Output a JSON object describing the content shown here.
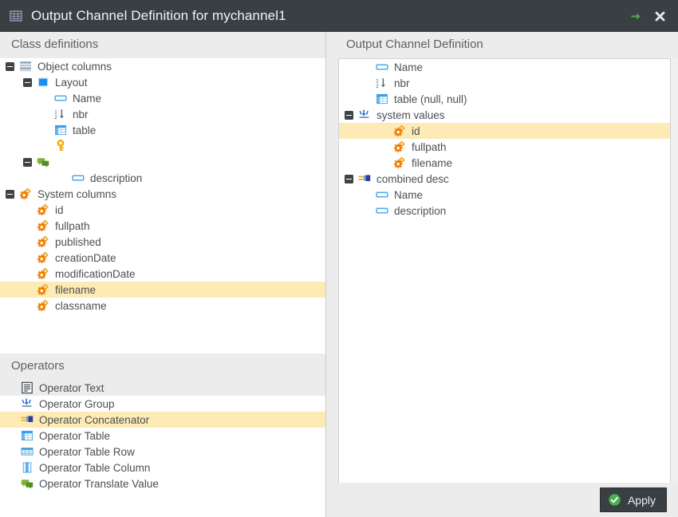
{
  "window": {
    "title": "Output Channel Definition for mychannel1",
    "title_icon": "table-grid-icon",
    "actions": [
      {
        "name": "open-arrow-icon",
        "glyph": "arrow-right"
      },
      {
        "name": "close-icon",
        "glyph": "close-x"
      }
    ],
    "colors": {
      "titlebar_bg": "#3a3f44",
      "panel_bg": "#ececec",
      "tree_bg": "#ffffff",
      "selection": "#fdeab4",
      "text": "#4a4f54",
      "header_text": "#5a6268",
      "accent_green": "#4caf50",
      "icon_orange": "#f29100",
      "icon_blue": "#1b8df0"
    }
  },
  "left_panel": {
    "class_definitions": {
      "header": "Class definitions",
      "nodes": [
        {
          "label": "Object columns",
          "indent": 0,
          "icon": "stack-rows-icon",
          "toggle": "minus",
          "selected": false
        },
        {
          "label": "Layout",
          "indent": 1,
          "icon": "square-blue-icon",
          "toggle": "minus",
          "selected": false
        },
        {
          "label": "Name",
          "indent": 2,
          "icon": "input-field-icon",
          "toggle": "none",
          "selected": false
        },
        {
          "label": "nbr",
          "indent": 2,
          "icon": "number-sort-icon",
          "toggle": "none",
          "selected": false
        },
        {
          "label": "table",
          "indent": 2,
          "icon": "table-icon",
          "toggle": "none",
          "selected": false
        },
        {
          "label": "",
          "indent": 2,
          "icon": "key-icon",
          "toggle": "none",
          "selected": false
        },
        {
          "label": "",
          "indent": 1,
          "icon": "translate-icon",
          "toggle": "minus",
          "selected": false
        },
        {
          "label": "description",
          "indent": 3,
          "icon": "input-field-icon",
          "toggle": "none",
          "selected": false
        },
        {
          "label": "System columns",
          "indent": 0,
          "icon": "gears-icon",
          "toggle": "minus",
          "selected": false
        },
        {
          "label": "id",
          "indent": 1,
          "icon": "gears-icon",
          "toggle": "none",
          "selected": false
        },
        {
          "label": "fullpath",
          "indent": 1,
          "icon": "gears-icon",
          "toggle": "none",
          "selected": false
        },
        {
          "label": "published",
          "indent": 1,
          "icon": "gears-icon",
          "toggle": "none",
          "selected": false
        },
        {
          "label": "creationDate",
          "indent": 1,
          "icon": "gears-icon",
          "toggle": "none",
          "selected": false
        },
        {
          "label": "modificationDate",
          "indent": 1,
          "icon": "gears-icon",
          "toggle": "none",
          "selected": false
        },
        {
          "label": "filename",
          "indent": 1,
          "icon": "gears-icon",
          "toggle": "none",
          "selected": true
        },
        {
          "label": "classname",
          "indent": 1,
          "icon": "gears-icon",
          "toggle": "none",
          "selected": false
        }
      ]
    },
    "operators": {
      "header": "Operators",
      "items": [
        {
          "label": "Operator Text",
          "icon": "document-text-icon",
          "state": "hover"
        },
        {
          "label": "Operator Group",
          "icon": "group-arrow-icon",
          "state": "normal"
        },
        {
          "label": "Operator Concatenator",
          "icon": "concatenator-icon",
          "state": "selected"
        },
        {
          "label": "Operator Table",
          "icon": "table-icon",
          "state": "normal"
        },
        {
          "label": "Operator Table Row",
          "icon": "table-row-icon",
          "state": "normal"
        },
        {
          "label": "Operator Table Column",
          "icon": "table-column-icon",
          "state": "normal"
        },
        {
          "label": "Operator Translate Value",
          "icon": "translate-icon",
          "state": "normal"
        }
      ]
    }
  },
  "right_panel": {
    "header": "Output Channel Definition",
    "nodes": [
      {
        "label": "Name",
        "indent": 1,
        "icon": "input-field-icon",
        "toggle": "none",
        "selected": false
      },
      {
        "label": "nbr",
        "indent": 1,
        "icon": "number-sort-icon",
        "toggle": "none",
        "selected": false
      },
      {
        "label": "table (null, null)",
        "indent": 1,
        "icon": "table-icon",
        "toggle": "none",
        "selected": false
      },
      {
        "label": "system values",
        "indent": 0,
        "icon": "group-arrow-icon",
        "toggle": "minus",
        "selected": false
      },
      {
        "label": "id",
        "indent": 2,
        "icon": "gears-icon",
        "toggle": "none",
        "selected": true
      },
      {
        "label": "fullpath",
        "indent": 2,
        "icon": "gears-icon",
        "toggle": "none",
        "selected": false
      },
      {
        "label": "filename",
        "indent": 2,
        "icon": "gears-icon",
        "toggle": "none",
        "selected": false
      },
      {
        "label": "combined desc",
        "indent": 0,
        "icon": "concatenator-icon",
        "toggle": "minus",
        "selected": false
      },
      {
        "label": "Name",
        "indent": 1,
        "icon": "input-field-icon",
        "toggle": "none",
        "selected": false
      },
      {
        "label": "description",
        "indent": 1,
        "icon": "input-field-icon",
        "toggle": "none",
        "selected": false
      }
    ],
    "apply_button": {
      "label": "Apply",
      "icon": "check-circle-icon"
    }
  }
}
